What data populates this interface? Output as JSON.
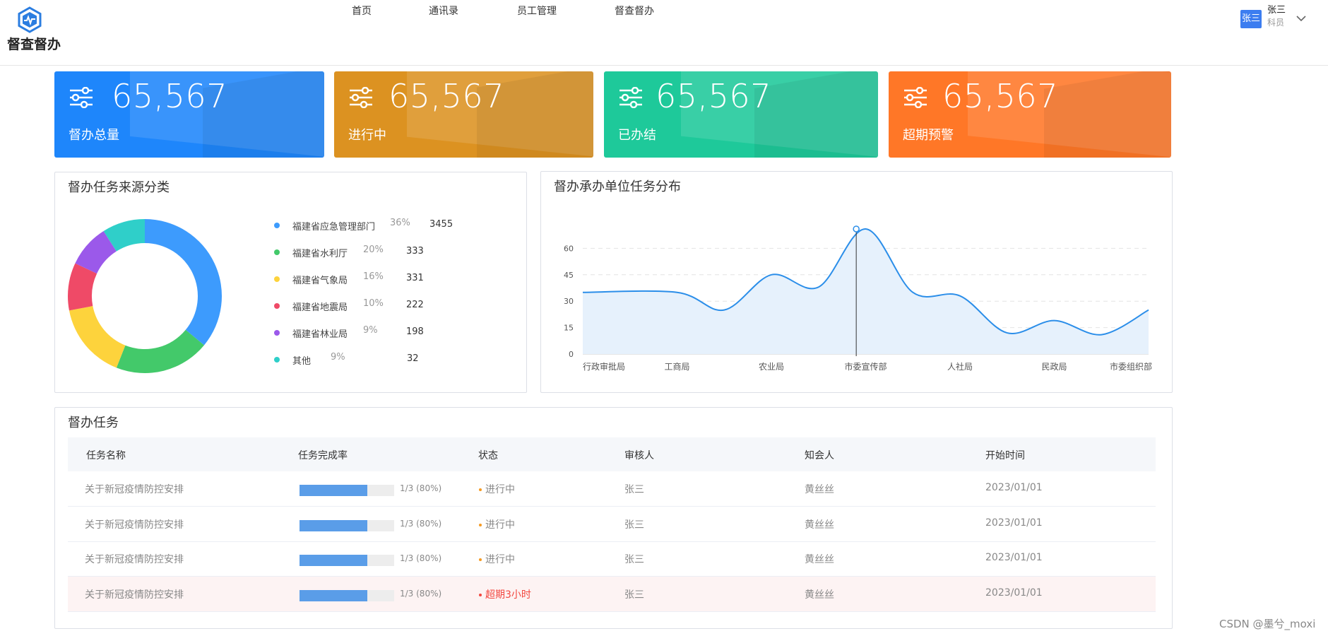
{
  "app": {
    "title": "督查督办"
  },
  "nav": [
    "首页",
    "通讯录",
    "员工管理",
    "督查督办"
  ],
  "user": {
    "avatar": "张三",
    "name": "张三",
    "role": "科员"
  },
  "cards": [
    {
      "value": "65,567",
      "label": "督办总量",
      "color": "#1e86fb"
    },
    {
      "value": "65,567",
      "label": "进行中",
      "color": "#dc9221"
    },
    {
      "value": "65,567",
      "label": "已办结",
      "color": "#1ec99a"
    },
    {
      "value": "65,567",
      "label": "超期预警",
      "color": "#ff7727"
    }
  ],
  "source_panel": {
    "title": "督办任务来源分类",
    "legend": [
      {
        "name": "福建省应急管理部门",
        "pct": "36%",
        "value": "3455",
        "color": "#3d9bfd"
      },
      {
        "name": "福建省水利厅",
        "pct": "20%",
        "value": "333",
        "color": "#43c96a"
      },
      {
        "name": "福建省气象局",
        "pct": "16%",
        "value": "331",
        "color": "#fdd33c"
      },
      {
        "name": "福建省地震局",
        "pct": "10%",
        "value": "222",
        "color": "#ef4a67"
      },
      {
        "name": "福建省林业局",
        "pct": "9%",
        "value": "198",
        "color": "#9b59ea"
      },
      {
        "name": "其他",
        "pct": "9%",
        "value": "32",
        "color": "#2fcfc9"
      }
    ]
  },
  "chart_panel": {
    "title": "督办承办单位任务分布"
  },
  "chart_data": {
    "type": "area",
    "categories": [
      "行政审批局",
      "工商局",
      "农业局",
      "市委宣传部",
      "人社局",
      "民政局",
      "市委组织部"
    ],
    "x": [
      0,
      1,
      1.5,
      2,
      2.5,
      3,
      3.5,
      4,
      4.5,
      5,
      5.5,
      6
    ],
    "values": [
      35,
      35,
      25,
      45,
      38,
      71,
      35,
      33,
      12,
      19,
      11,
      25
    ],
    "highlight_x": 2.9,
    "yticks": [
      0,
      15,
      30,
      45,
      60
    ],
    "ylim": [
      0,
      75
    ],
    "grid": true,
    "line_color": "#2b8ee9",
    "fill_color": "#e6f1fc"
  },
  "task_panel": {
    "title": "督办任务",
    "headers": [
      "任务名称",
      "任务完成率",
      "状态",
      "审核人",
      "知会人",
      "开始时间"
    ],
    "rows": [
      {
        "name": "关于新冠疫情防控安排",
        "progress": 0.8,
        "progress_text": "1/3 (80%)",
        "status": "进行中",
        "warn": false,
        "reviewer": "张三",
        "notify": "黄丝丝",
        "start": "2023/01/01"
      },
      {
        "name": "关于新冠疫情防控安排",
        "progress": 0.8,
        "progress_text": "1/3 (80%)",
        "status": "进行中",
        "warn": false,
        "reviewer": "张三",
        "notify": "黄丝丝",
        "start": "2023/01/01"
      },
      {
        "name": "关于新冠疫情防控安排",
        "progress": 0.8,
        "progress_text": "1/3 (80%)",
        "status": "进行中",
        "warn": false,
        "reviewer": "张三",
        "notify": "黄丝丝",
        "start": "2023/01/01"
      },
      {
        "name": "关于新冠疫情防控安排",
        "progress": 0.8,
        "progress_text": "1/3 (80%)",
        "status": "超期3小时",
        "warn": true,
        "reviewer": "张三",
        "notify": "黄丝丝",
        "start": "2023/01/01"
      }
    ]
  },
  "watermark": "CSDN @墨兮_moxi"
}
